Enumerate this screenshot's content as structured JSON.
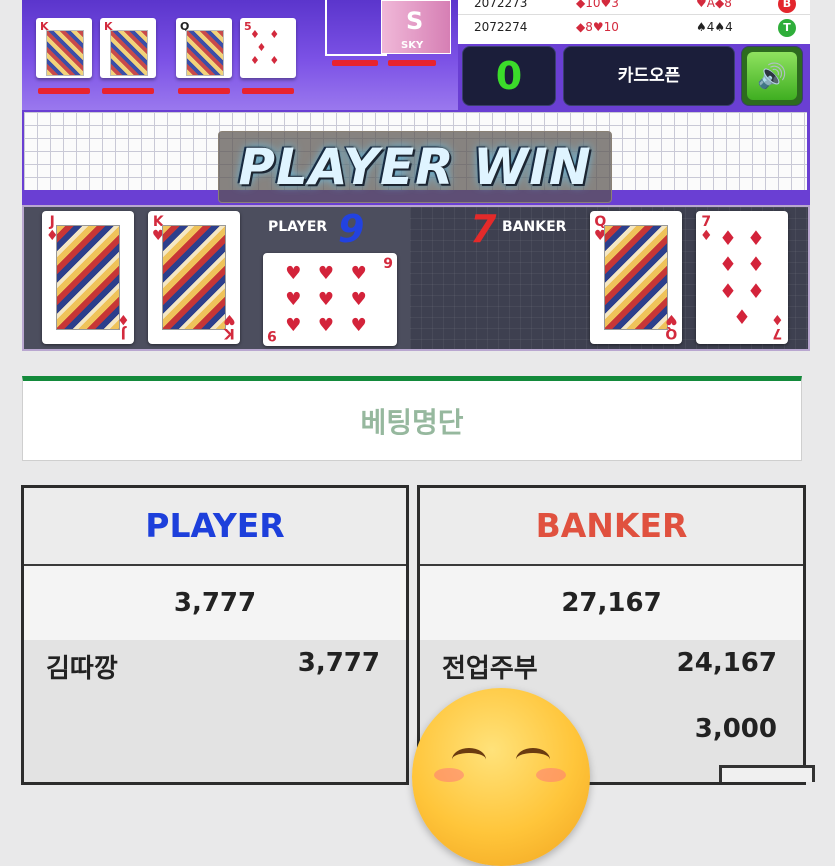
{
  "game": {
    "history": [
      {
        "round": "2072273",
        "player_cards": "◆10♥3",
        "banker_cards": "♥A◆8",
        "result": "B",
        "result_color": "#e3262d"
      },
      {
        "round": "2072274",
        "player_cards": "◆8♥10",
        "banker_cards": "♠4♠4",
        "result": "T",
        "result_color": "#2fae3a"
      }
    ],
    "count": "0",
    "open_button": "카드오픈",
    "sound_icon": "speaker-icon",
    "sky_card_text": "SKY",
    "sky_card_symbol": "S",
    "banner": "PLAYER WIN",
    "player": {
      "label": "PLAYER",
      "score": "9",
      "cards": [
        {
          "rank": "J",
          "suit": "♦",
          "type": "court"
        },
        {
          "rank": "K",
          "suit": "♥",
          "type": "court"
        },
        {
          "rank": "9",
          "suit": "♥",
          "type": "pips",
          "pips": "♥♥♥♥♥♥♥♥♥"
        }
      ]
    },
    "banker": {
      "label": "BANKER",
      "score": "7",
      "cards": [
        {
          "rank": "Q",
          "suit": "♥",
          "type": "court"
        },
        {
          "rank": "7",
          "suit": "♦",
          "type": "pips",
          "pips": "♦♦♦♦♦♦♦"
        }
      ]
    },
    "table_cards": [
      {
        "rank": "K",
        "suit": "♦"
      },
      {
        "rank": "K",
        "suit": "♥"
      },
      {
        "rank": "Q",
        "suit": "♣"
      },
      {
        "rank": "5",
        "suit": "♦"
      }
    ]
  },
  "betting": {
    "title": "베팅명단",
    "player": {
      "header": "PLAYER",
      "header_color": "#1d3fdb",
      "total": "3,777",
      "rows": [
        {
          "name": "김따깡",
          "amount": "3,777"
        }
      ]
    },
    "banker": {
      "header": "BANKER",
      "header_color": "#e0513f",
      "total": "27,167",
      "rows": [
        {
          "name": "전업주부",
          "amount": "24,167"
        },
        {
          "name": "",
          "amount": "3,000"
        }
      ]
    }
  },
  "overlay": {
    "emoji_icon": "smiling-face-emoji"
  }
}
